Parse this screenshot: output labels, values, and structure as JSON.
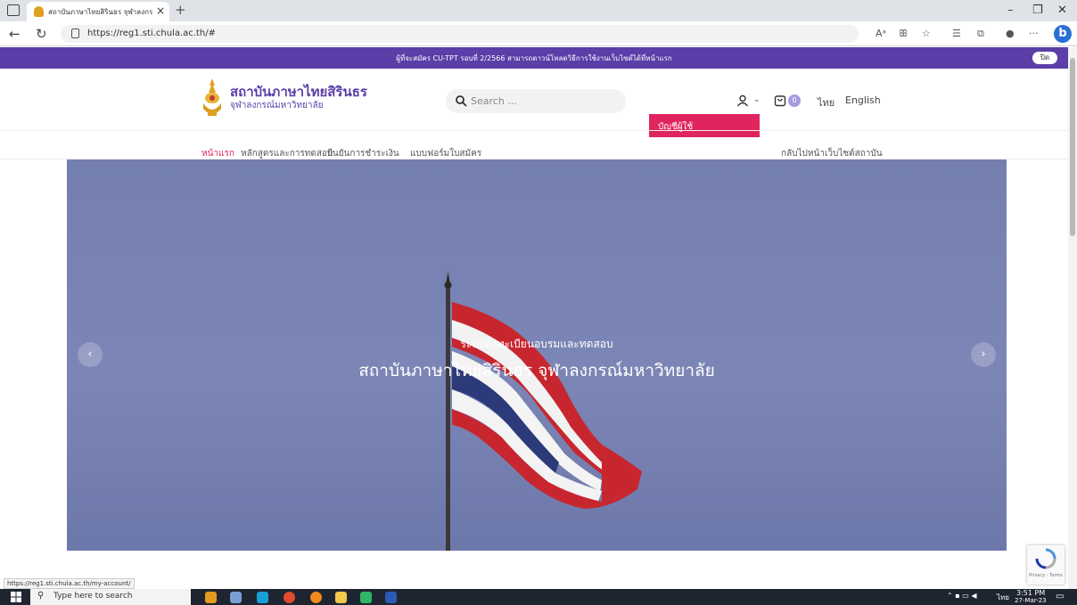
{
  "browser": {
    "tab_title": "สถาบันภาษาไทยสิรินธร จุฬาลงกรณ์มหาวิทยาลัย",
    "tab_close": "×",
    "new_tab": "+",
    "url": "https://reg1.sti.chula.ac.th/#",
    "status_url": "https://reg1.sti.chula.ac.th/my-account/",
    "window_controls": {
      "minimize": "–",
      "maximize": "❐",
      "close": "✕"
    },
    "bing_label": "b"
  },
  "announcement": {
    "text": "ผู้ที่จะสมัคร CU-TPT รอบที่ 2/2566 สามารถดาวน์โหลดวิธีการใช้งานเว็บไซต์ได้ที่หน้าแรก",
    "close_label": "ปิด"
  },
  "header": {
    "logo_title": "สถาบันภาษาไทยสิรินธร",
    "logo_subtitle": "จุฬาลงกรณ์มหาวิทยาลัย",
    "search_placeholder": "Search ...",
    "cart_count": "0",
    "lang_th": "ไทย",
    "lang_en": "English",
    "account_dropdown_item": "บัญชีผู้ใช้"
  },
  "nav": {
    "items": [
      "หน้าแรก",
      "หลักสูตรและการทดสอบ",
      "ยืนยันการชำระเงิน",
      "แบบฟอร์มใบสมัคร"
    ],
    "back_link": "กลับไปหน้าเว็บไซต์สถาบัน"
  },
  "hero": {
    "subtitle": "ระบบลงทะเบียนอบรมและทดสอบ",
    "title": "สถาบันภาษาไทยสิรินธร จุฬาลงกรณ์มหาวิทยาลัย",
    "prev_label": "‹",
    "next_label": "›"
  },
  "recaptcha": {
    "label": "Privacy - Terms"
  },
  "taskbar": {
    "search_placeholder": "Type here to search",
    "time": "3:51 PM",
    "date": "27-Mar-23",
    "lang": "ไทย"
  },
  "colors": {
    "brand_purple": "#5b3ea8",
    "accent_pink": "#e0245e",
    "hero_blue": "#767fb0"
  }
}
